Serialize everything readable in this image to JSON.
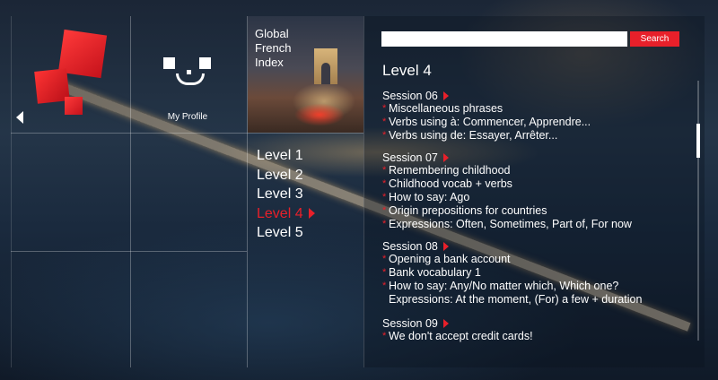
{
  "profile": {
    "label": "My Profile"
  },
  "tile": {
    "title": "Global French Index"
  },
  "levels": {
    "items": [
      {
        "label": "Level 1",
        "active": false
      },
      {
        "label": "Level 2",
        "active": false
      },
      {
        "label": "Level 3",
        "active": false
      },
      {
        "label": "Level 4",
        "active": true
      },
      {
        "label": "Level 5",
        "active": false
      }
    ]
  },
  "search": {
    "placeholder": "",
    "value": "",
    "button_label": "Search"
  },
  "content": {
    "heading": "Level 4",
    "sessions": [
      {
        "title": "Session 06",
        "items": [
          {
            "text": "Miscellaneous phrases",
            "bullet": true
          },
          {
            "text": "Verbs using à: Commencer, Apprendre...",
            "bullet": true
          },
          {
            "text": "Verbs using de: Essayer, Arrêter...",
            "bullet": true
          }
        ]
      },
      {
        "title": "Session 07",
        "items": [
          {
            "text": "Remembering childhood",
            "bullet": true
          },
          {
            "text": "Childhood vocab + verbs",
            "bullet": true
          },
          {
            "text": "How to say: Ago",
            "bullet": true
          },
          {
            "text": "Origin prepositions for countries",
            "bullet": true
          },
          {
            "text": "Expressions: Often, Sometimes, Part of, For now",
            "bullet": true
          }
        ]
      },
      {
        "title": "Session 08",
        "items": [
          {
            "text": "Opening a bank account",
            "bullet": true
          },
          {
            "text": "Bank vocabulary 1",
            "bullet": true
          },
          {
            "text": "How to say: Any/No matter which, Which one?",
            "bullet": true
          },
          {
            "text": "Expressions: At the moment, (For) a few + duration",
            "bullet": false
          }
        ]
      },
      {
        "title": "Session 09",
        "items": [
          {
            "text": "We don't accept credit cards!",
            "bullet": true
          }
        ]
      }
    ]
  },
  "colors": {
    "accent": "#e8202a"
  }
}
